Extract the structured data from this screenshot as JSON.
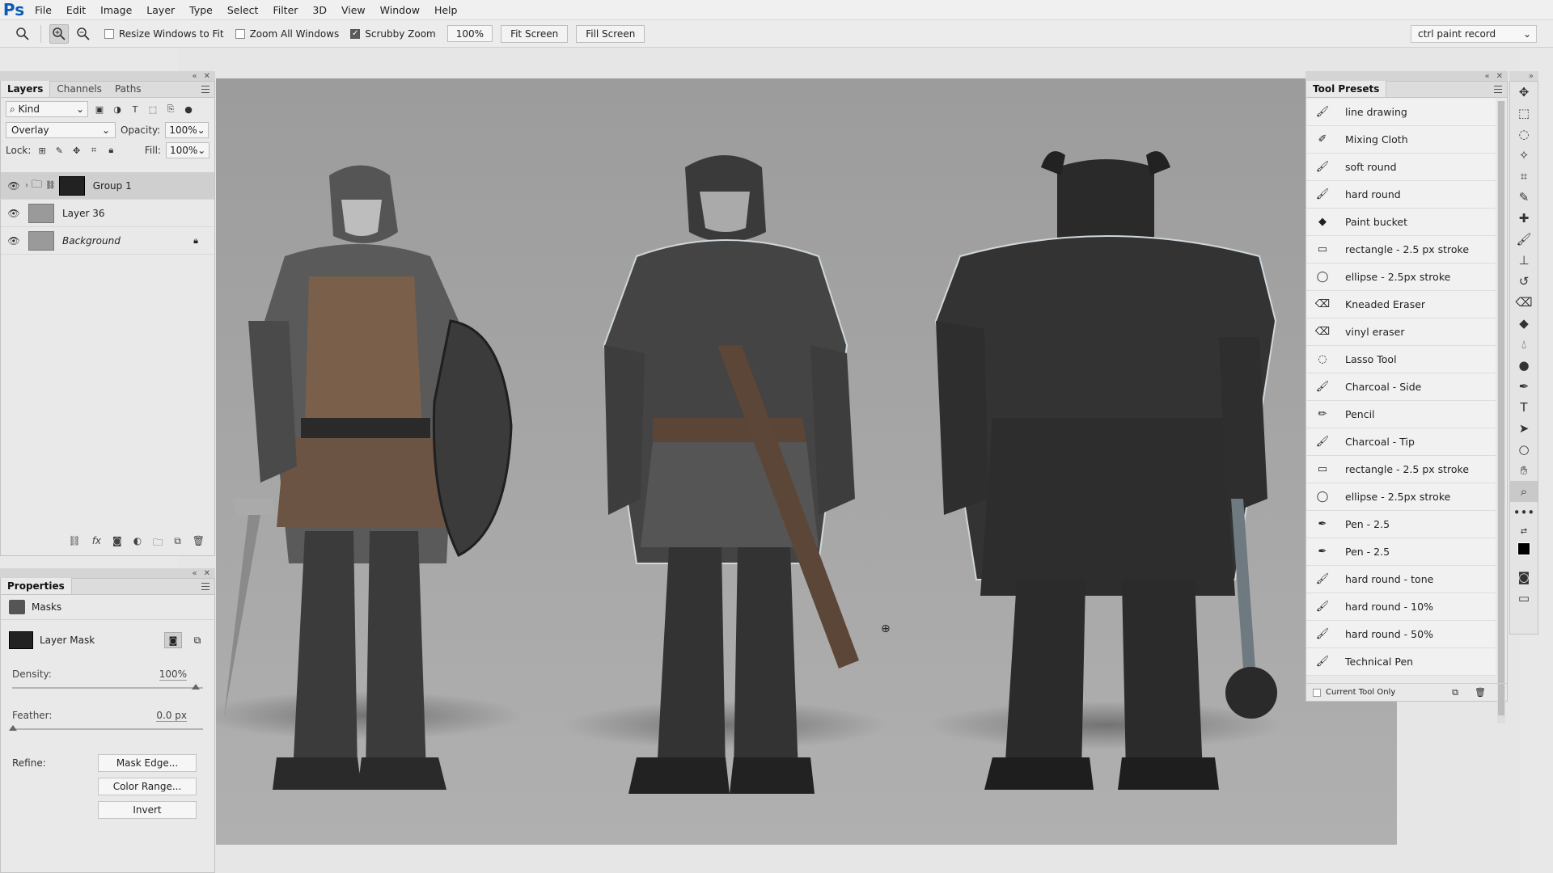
{
  "menu": {
    "logo": "Ps",
    "items": [
      "File",
      "Edit",
      "Image",
      "Layer",
      "Type",
      "Select",
      "Filter",
      "3D",
      "View",
      "Window",
      "Help"
    ]
  },
  "options": {
    "resize_windows": "Resize Windows to Fit",
    "zoom_all": "Zoom All Windows",
    "scrubby_zoom": "Scrubby Zoom",
    "zoom_value": "100%",
    "fit_screen": "Fit Screen",
    "fill_screen": "Fill Screen",
    "workspace": "ctrl paint record"
  },
  "layers_panel": {
    "tabs": [
      "Layers",
      "Channels",
      "Paths"
    ],
    "kind": "Kind",
    "blend_mode": "Overlay",
    "opacity_label": "Opacity:",
    "opacity": "100%",
    "lock_label": "Lock:",
    "fill_label": "Fill:",
    "fill": "100%",
    "layers": [
      {
        "name": "Group 1"
      },
      {
        "name": "Layer 36"
      },
      {
        "name": "Background"
      }
    ]
  },
  "properties_panel": {
    "tab": "Properties",
    "section": "Masks",
    "mask_label": "Layer Mask",
    "density_label": "Density:",
    "density": "100%",
    "feather_label": "Feather:",
    "feather": "0.0 px",
    "refine_label": "Refine:",
    "mask_edge": "Mask Edge...",
    "color_range": "Color Range...",
    "invert": "Invert"
  },
  "tool_presets": {
    "tab": "Tool Presets",
    "items": [
      {
        "label": "line drawing",
        "icon": "brush-icon"
      },
      {
        "label": "Mixing Cloth",
        "icon": "mixer-brush-icon"
      },
      {
        "label": "soft round",
        "icon": "brush-icon"
      },
      {
        "label": "hard round",
        "icon": "brush-icon"
      },
      {
        "label": "Paint bucket",
        "icon": "paint-bucket-icon"
      },
      {
        "label": "rectangle - 2.5 px stroke",
        "icon": "rectangle-icon"
      },
      {
        "label": "ellipse - 2.5px stroke",
        "icon": "ellipse-icon"
      },
      {
        "label": "Kneaded Eraser",
        "icon": "eraser-icon"
      },
      {
        "label": "vinyl eraser",
        "icon": "eraser-icon"
      },
      {
        "label": "Lasso Tool",
        "icon": "lasso-icon"
      },
      {
        "label": "Charcoal - Side",
        "icon": "brush-icon"
      },
      {
        "label": "Pencil",
        "icon": "pencil-icon"
      },
      {
        "label": "Charcoal - Tip",
        "icon": "brush-icon"
      },
      {
        "label": "rectangle - 2.5 px stroke",
        "icon": "rectangle-icon"
      },
      {
        "label": "ellipse - 2.5px stroke",
        "icon": "ellipse-icon"
      },
      {
        "label": "Pen - 2.5",
        "icon": "pen-icon"
      },
      {
        "label": "Pen - 2.5",
        "icon": "pen-icon"
      },
      {
        "label": "hard round - tone",
        "icon": "brush-icon"
      },
      {
        "label": "hard round - 10%",
        "icon": "brush-icon"
      },
      {
        "label": "hard round - 50%",
        "icon": "brush-icon"
      },
      {
        "label": "Technical Pen",
        "icon": "brush-icon"
      }
    ],
    "current_tool_only": "Current Tool Only"
  }
}
